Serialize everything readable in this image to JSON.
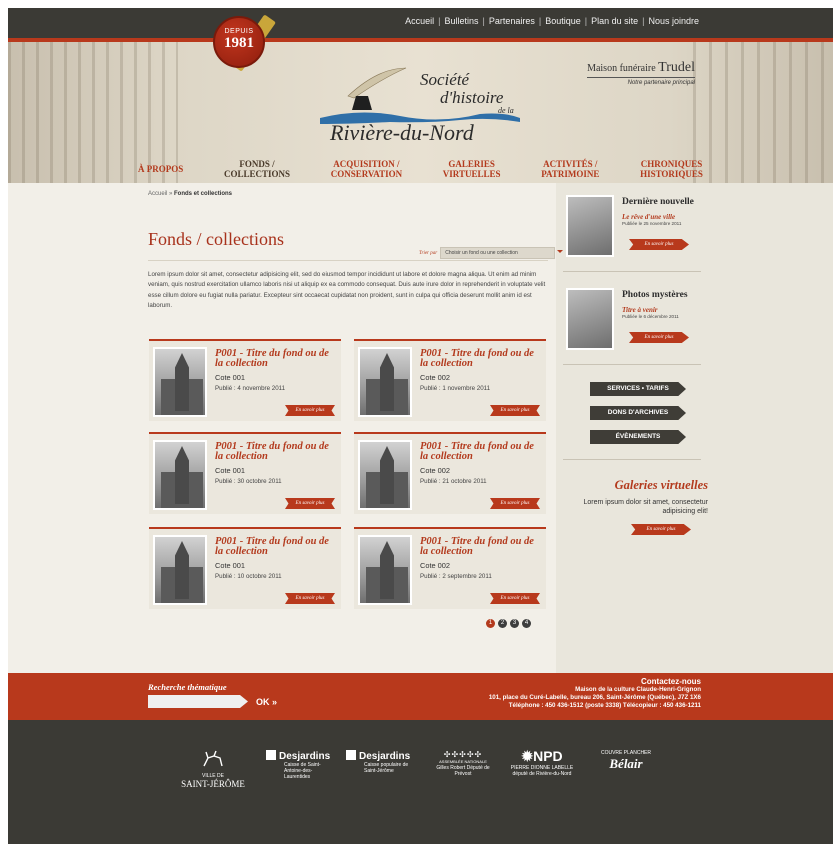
{
  "topnav": [
    "Accueil",
    "Bulletins",
    "Partenaires",
    "Boutique",
    "Plan du site",
    "Nous joindre"
  ],
  "seal": {
    "label": "DEPUIS",
    "year": "1981"
  },
  "logo": {
    "line1": "Société",
    "line2": "d'histoire",
    "line3": "de la",
    "line4": "Rivière-du-Nord"
  },
  "partner": {
    "prefix": "Maison funéraire",
    "name": "Trudel",
    "tagline": "Notre partenaire principal"
  },
  "mainnav": [
    {
      "line1": "À PROPOS",
      "line2": ""
    },
    {
      "line1": "FONDS /",
      "line2": "COLLECTIONS"
    },
    {
      "line1": "ACQUISITION /",
      "line2": "CONSERVATION"
    },
    {
      "line1": "GALERIES",
      "line2": "VIRTUELLES"
    },
    {
      "line1": "ACTIVITÉS /",
      "line2": "PATRIMOINE"
    },
    {
      "line1": "CHRONIQUES",
      "line2": "HISTORIQUES"
    }
  ],
  "breadcrumb": {
    "home": "Accueil",
    "sep": " » ",
    "current": "Fonds et collections"
  },
  "page_title": "Fonds / collections",
  "filter": {
    "label": "Trier par",
    "value": "Choisir un fond ou une collection"
  },
  "intro": "Lorem ipsum dolor sit amet, consectetur adipisicing elit, sed do eiusmod tempor incididunt ut labore et dolore magna aliqua. Ut enim ad minim veniam, quis nostrud exercitation ullamco laboris nisi ut aliquip ex ea commodo consequat. Duis aute irure dolor in reprehenderit in voluptate velit esse cillum dolore eu fugiat nulla pariatur. Excepteur sint occaecat cupidatat non proident, sunt in culpa qui officia deserunt mollit anim id est laborum.",
  "cards": [
    {
      "title": "P001 - Titre du fond ou de la collection",
      "code": "Cote 001",
      "date": "Publié : 4 novembre 2011",
      "more": "En savoir plus"
    },
    {
      "title": "P001 - Titre du fond ou de la collection",
      "code": "Cote 002",
      "date": "Publié : 1 novembre 2011",
      "more": "En savoir plus"
    },
    {
      "title": "P001 - Titre du fond ou de la collection",
      "code": "Cote 001",
      "date": "Publié : 30 octobre 2011",
      "more": "En savoir plus"
    },
    {
      "title": "P001 - Titre du fond ou de la collection",
      "code": "Cote 002",
      "date": "Publié : 21 octobre 2011",
      "more": "En savoir plus"
    },
    {
      "title": "P001 - Titre du fond ou de la collection",
      "code": "Cote 001",
      "date": "Publié : 10 octobre 2011",
      "more": "En savoir plus"
    },
    {
      "title": "P001 - Titre du fond ou de la collection",
      "code": "Cote 002",
      "date": "Publié : 2 septembre 2011",
      "more": "En savoir plus"
    }
  ],
  "pager": [
    "1",
    "2",
    "3",
    "4"
  ],
  "sidebar": {
    "news": [
      {
        "heading": "Dernière nouvelle",
        "title": "Le rêve d'une ville",
        "date": "Publiée le 25 novembre 2011",
        "more": "En savoir plus"
      },
      {
        "heading": "Photos mystères",
        "title": "Titre à venir",
        "date": "Publiée le 6 décembre 2011",
        "more": "En savoir plus"
      }
    ],
    "buttons": [
      "SERVICES • TARIFS",
      "DONS D'ARCHIVES",
      "ÉVÈNEMENTS"
    ],
    "galeries": {
      "heading": "Galeries virtuelles",
      "text": "Lorem ipsum dolor sit amet, consectetur adipisicing elit!",
      "more": "En savoir plus"
    }
  },
  "search": {
    "label": "Recherche thématique",
    "placeholder": "",
    "button": "OK »"
  },
  "contact": {
    "heading": "Contactez-nous",
    "line1": "Maison de la culture Claude-Henri-Grignon",
    "line2": "101, place du Curé-Labelle, bureau 206, Saint-Jérôme (Québec), J7Z 1X6",
    "line3": "Téléphone : 450 436-1512 (poste 3338)    Télécopieur : 450 436-1211"
  },
  "sponsors": [
    {
      "name": "SAINT-JÉRÔME",
      "sub": "VILLE DE"
    },
    {
      "name": "Desjardins",
      "sub": "Caisse de Saint-Antoine-des-Laurentides"
    },
    {
      "name": "Desjardins",
      "sub": "Caisse populaire de Saint-Jérôme"
    },
    {
      "name": "ASSEMBLÉE NATIONALE",
      "sub": "Gilles Robert Député de Prévost"
    },
    {
      "name": "NPD",
      "sub": "PIERRE DIONNE LABELLE député de Rivière-du-Nord"
    },
    {
      "name": "Bélair",
      "sub": "COUVRE PLANCHER"
    }
  ],
  "colors": {
    "accent": "#b8391c",
    "dark": "#3b3a35",
    "bg": "#e9e5da"
  }
}
